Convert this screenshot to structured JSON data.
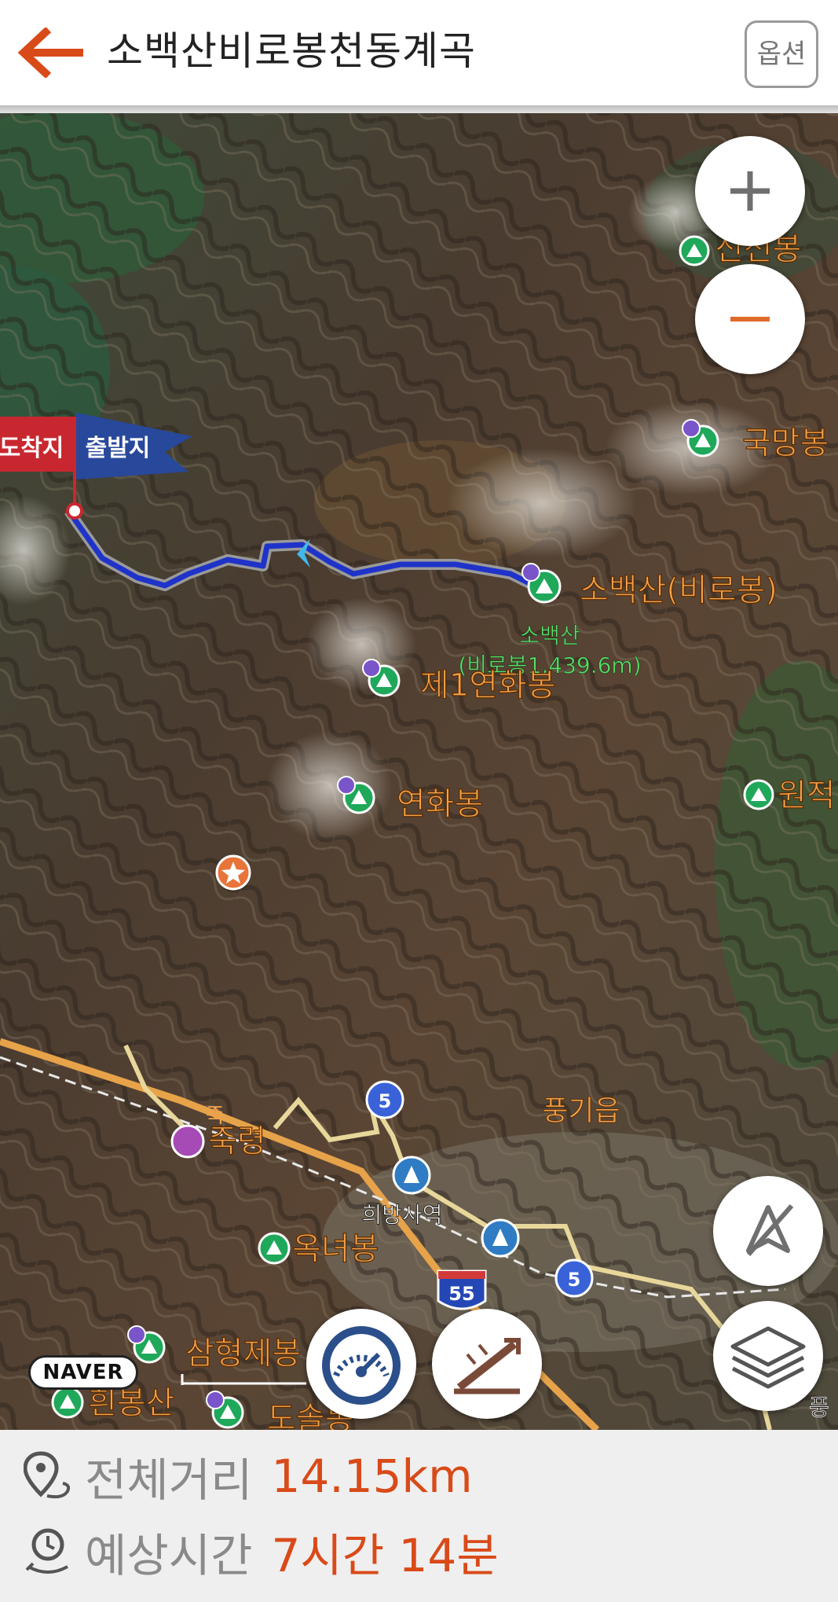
{
  "header": {
    "title": "소백산비로봉천동계곡",
    "option_label": "옵션"
  },
  "map": {
    "attribution": "NAVER",
    "peaks": {
      "sinseonbong": "신선봉",
      "gukmangbong": "국망봉",
      "sobaeksan": "소백산(비로봉)",
      "sobaeksan_info_1": "소백산",
      "sobaeksan_info_2": "(비로봉1,439.6m)",
      "yeonhwabong1": "제1연화봉",
      "yeonhwabong": "연화봉",
      "wonjeok": "원적",
      "oknyeobong": "옥녀봉",
      "samhyeongje": "삼형제봉",
      "heunbongsan": "흰봉산",
      "dosolbong": "도솔봉"
    },
    "places": {
      "punggi": "풍기읍",
      "jungnyeong": "죽령",
      "heebang": "희방사역",
      "pung_partial": "풍",
      "jung_partial": "죽",
      "jung_cyan": "죽"
    },
    "flags": {
      "arrival": "도착지",
      "departure": "출발지"
    },
    "road_badges": {
      "r5a": "5",
      "r5b": "5",
      "hw55": "55"
    },
    "colors": {
      "route": "#1f33c9",
      "accent": "#d94a19",
      "label_orange": "#f3a24a"
    }
  },
  "controls": {
    "zoom_in_icon": "plus-icon",
    "zoom_out_icon": "minus-icon",
    "compass_icon": "compass-off-icon",
    "layers_icon": "layers-icon",
    "speed_icon": "speedometer-icon",
    "incline_icon": "incline-icon"
  },
  "summary": {
    "distance_label": "전체거리",
    "distance_value": "14.15km",
    "time_label": "예상시간",
    "time_value": "7시간 14분"
  }
}
